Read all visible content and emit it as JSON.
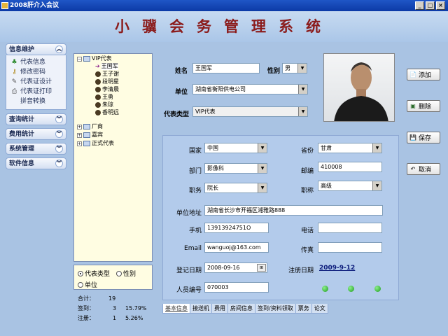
{
  "window": {
    "title": "2008肝介入会议",
    "min": "_",
    "max": "□",
    "close": "×"
  },
  "banner": {
    "title": "小骥会务管理系统"
  },
  "sidebar": {
    "groups": [
      {
        "label": "信息维护",
        "items": [
          {
            "label": "代表信息",
            "icon": "person-group-icon"
          },
          {
            "label": "修改密码",
            "icon": "key-icon"
          },
          {
            "label": "代表证设计",
            "icon": "tools-icon"
          },
          {
            "label": "代表证打印",
            "icon": "printer-icon"
          },
          {
            "label": "拼音转换",
            "icon": "none"
          }
        ]
      },
      {
        "label": "查询统计"
      },
      {
        "label": "费用统计"
      },
      {
        "label": "系统管理"
      },
      {
        "label": "软件信息"
      }
    ]
  },
  "tree": {
    "root": "VIP代表",
    "children": [
      "王国军",
      "王子谢",
      "段明星",
      "李清晨",
      "王勇",
      "朱琼",
      "香明远"
    ],
    "siblings": [
      "厂商",
      "嘉宾",
      "正式代表"
    ]
  },
  "filter": {
    "opt1": "代表类型",
    "opt2": "性别",
    "opt3": "单位"
  },
  "stats": {
    "total_label": "合计：",
    "total": "19",
    "signed_label": "签到：",
    "signed": "3",
    "signed_pct": "15.79%",
    "reg_label": "注册：",
    "reg": "1",
    "reg_pct": "5.26%"
  },
  "form": {
    "name_label": "姓名",
    "name": "王国军",
    "gender_label": "性别",
    "gender": "男",
    "unit_label": "单位",
    "unit": "湖南省衡阳供电公司",
    "type_label": "代表类型",
    "type": "VIP代表"
  },
  "detail": {
    "country_label": "国家",
    "country": "中国",
    "province_label": "省份",
    "province": "甘肃",
    "dept_label": "部门",
    "dept": "影像科",
    "postcode_label": "邮编",
    "postcode": "410008",
    "duty_label": "职务",
    "duty": "院长",
    "title_label": "职称",
    "title": "高级",
    "address_label": "单位地址",
    "address": "湖南省长沙市开福区湘雅路888",
    "mobile_label": "手机",
    "mobile": "13913924751O",
    "phone_label": "电话",
    "phone": "",
    "email_label": "Email",
    "email": "wanguoj@163.com",
    "fax_label": "传真",
    "fax": "",
    "regdate_label": "登记日期",
    "regdate": "2008-09-16",
    "enrolldate_label": "注册日期",
    "enrolldate": "2009-9-12",
    "staffno_label": "人员编号",
    "staffno": "070003"
  },
  "buttons": {
    "add": "添加",
    "delete": "删除",
    "save": "保存",
    "cancel": "取消"
  },
  "tabs": [
    "基本信息",
    "接送机",
    "费用",
    "房间信息",
    "签到/资料领取",
    "票务",
    "论文"
  ]
}
